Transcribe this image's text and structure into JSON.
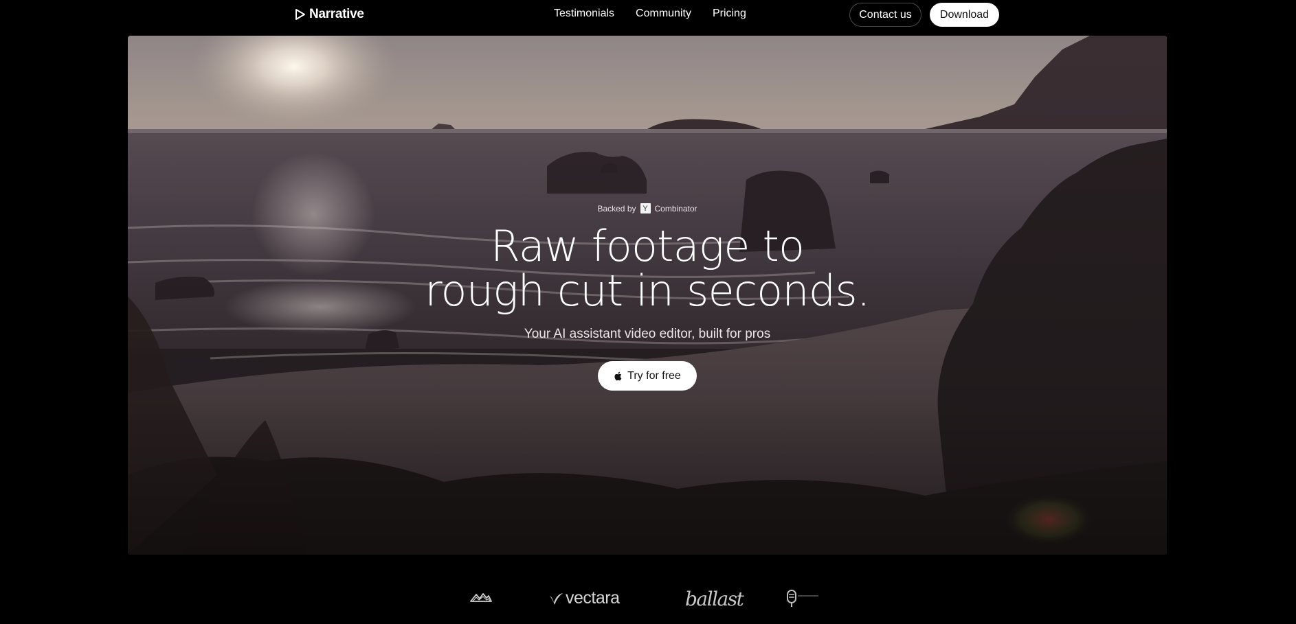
{
  "nav": {
    "brand": "Narrative",
    "links": [
      "Testimonials",
      "Community",
      "Pricing"
    ],
    "contact_label": "Contact us",
    "download_label": "Download"
  },
  "hero": {
    "backed_prefix": "Backed by",
    "yc_letter": "Y",
    "backed_suffix": "Combinator",
    "headline_line1": "Raw footage to",
    "headline_line2": "rough cut in seconds.",
    "subheadline": "Your AI assistant video editor, built for pros",
    "cta_label": "Try for free"
  },
  "logos": {
    "vectara": "vectara",
    "ballast": "ballast"
  },
  "colors": {
    "background": "#000000",
    "button_light": "#ffffff",
    "outline_border": "#4a4a4a"
  },
  "icons": [
    "play-triangle-icon",
    "apple-icon",
    "mountains-logo-icon",
    "vectara-check-icon",
    "microphone-logo-icon"
  ]
}
